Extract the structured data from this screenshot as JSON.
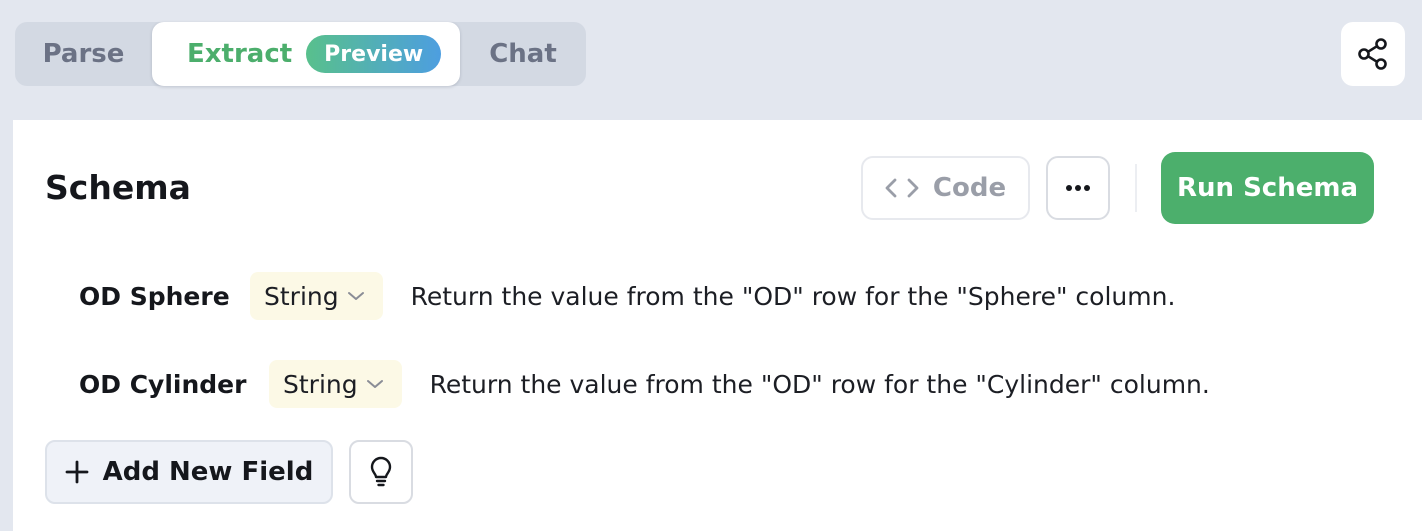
{
  "tabs": {
    "parse": "Parse",
    "extract": "Extract",
    "extract_badge": "Preview",
    "chat": "Chat"
  },
  "share": {
    "icon": "share-icon"
  },
  "schema": {
    "title": "Schema",
    "code_label": "Code",
    "code_icon": "code-brackets-icon",
    "more_icon": "more-horizontal-icon",
    "run_label": "Run Schema"
  },
  "fields": [
    {
      "name": "OD Sphere",
      "type": "String",
      "description": "Return the value from the \"OD\" row for the \"Sphere\" column."
    },
    {
      "name": "OD Cylinder",
      "type": "String",
      "description": "Return the value from the \"OD\" row for the \"Cylinder\" column."
    }
  ],
  "actions": {
    "add_field_label": "Add New Field",
    "add_icon": "plus-icon",
    "suggest_icon": "lightbulb-icon"
  },
  "colors": {
    "accent_green": "#4caf6c",
    "badge_gradient_start": "#58c08c",
    "badge_gradient_end": "#4d9ee0",
    "type_chip_bg": "#fcf9e6",
    "page_bg": "#e3e7ef"
  }
}
